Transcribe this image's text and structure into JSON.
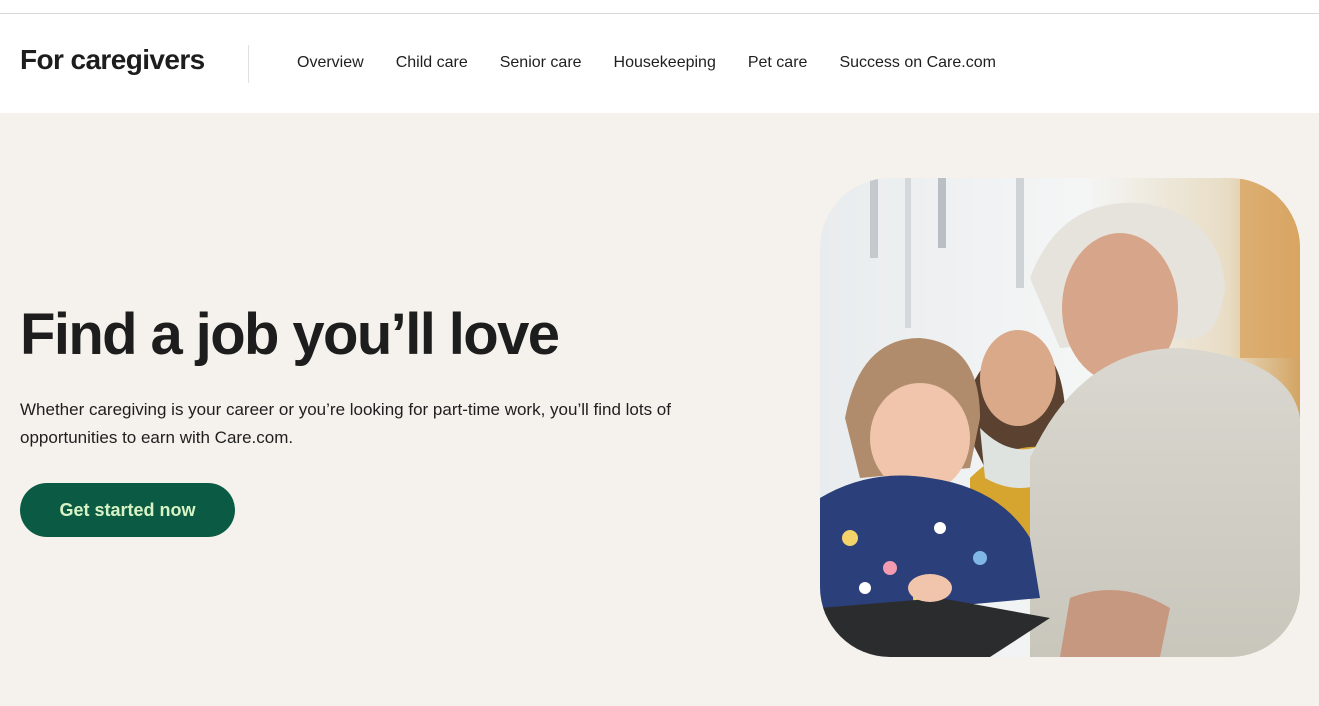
{
  "header": {
    "brand": "For caregivers",
    "nav": [
      "Overview",
      "Child care",
      "Senior care",
      "Housekeeping",
      "Pet care",
      "Success on Care.com"
    ]
  },
  "hero": {
    "title": "Find a job you’ll love",
    "subtitle": "Whether caregiving is your career or you’re looking for part-time work, you’ll find lots of opportunities to earn with Care.com.",
    "cta_label": "Get started now"
  },
  "colors": {
    "hero_background": "#f5f1ec",
    "cta_background": "#0b5a43",
    "cta_text": "#d7f3c6"
  },
  "icons": [
    "hero-photo"
  ]
}
